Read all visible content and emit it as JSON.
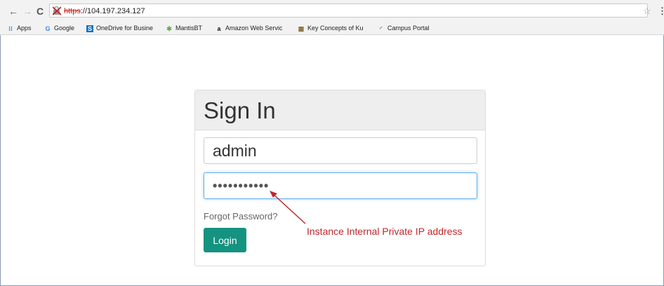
{
  "browser": {
    "nav": {
      "back": "←",
      "forward": "→",
      "reload": "C"
    },
    "url": {
      "scheme": "https",
      "rest": "://104.197.234.127"
    },
    "star": "☆",
    "menu": "⋮",
    "bookmarks": [
      {
        "label": "Apps",
        "icon": "apps-grid-icon",
        "glyph": "⁝⁝",
        "color": "#1a73e8"
      },
      {
        "label": "Google",
        "icon": "google-icon",
        "glyph": "G",
        "color": "#4285f4"
      },
      {
        "label": "OneDrive for Busine",
        "icon": "onedrive-icon",
        "glyph": "S",
        "color": "#0f6fc6"
      },
      {
        "label": "MantisBT",
        "icon": "mantis-icon",
        "glyph": "✱",
        "color": "#6aa84f"
      },
      {
        "label": "Amazon Web Servic",
        "icon": "amazon-icon",
        "glyph": "a",
        "color": "#111111"
      },
      {
        "label": "Key Concepts of Ku",
        "icon": "book-icon",
        "glyph": "▦",
        "color": "#8a6d3b"
      },
      {
        "label": "Campus Portal",
        "icon": "loading-icon",
        "glyph": "◜",
        "color": "#888888"
      }
    ]
  },
  "signin": {
    "title": "Sign In",
    "username": "admin",
    "password_mask": "•••••••••••",
    "forgot": "Forgot Password?",
    "login": "Login"
  },
  "annotation": {
    "text": "Instance Internal Private IP address",
    "color": "#c0262a"
  }
}
